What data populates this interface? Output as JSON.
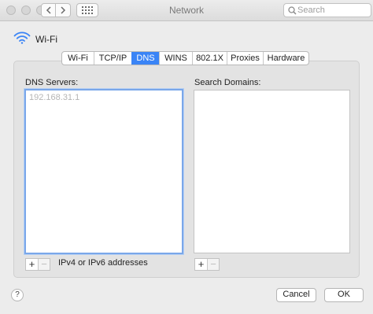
{
  "window": {
    "title": "Network"
  },
  "search": {
    "placeholder": "Search",
    "value": ""
  },
  "interface": {
    "name": "Wi-Fi",
    "icon": "wifi-icon"
  },
  "tabs": [
    {
      "label": "Wi-Fi",
      "active": false
    },
    {
      "label": "TCP/IP",
      "active": false
    },
    {
      "label": "DNS",
      "active": true
    },
    {
      "label": "WINS",
      "active": false
    },
    {
      "label": "802.1X",
      "active": false
    },
    {
      "label": "Proxies",
      "active": false
    },
    {
      "label": "Hardware",
      "active": false
    }
  ],
  "dns": {
    "label": "DNS Servers:",
    "entries": [
      "192.168.31.1"
    ],
    "hint": "IPv4 or IPv6 addresses",
    "add_label": "+",
    "remove_label": "−"
  },
  "search_domains": {
    "label": "Search Domains:",
    "entries": [],
    "add_label": "+",
    "remove_label": "−"
  },
  "buttons": {
    "help": "?",
    "cancel": "Cancel",
    "ok": "OK"
  },
  "colors": {
    "accent": "#3a84f6",
    "focus_ring": "#7aa7e9",
    "window_bg": "#ececec"
  }
}
